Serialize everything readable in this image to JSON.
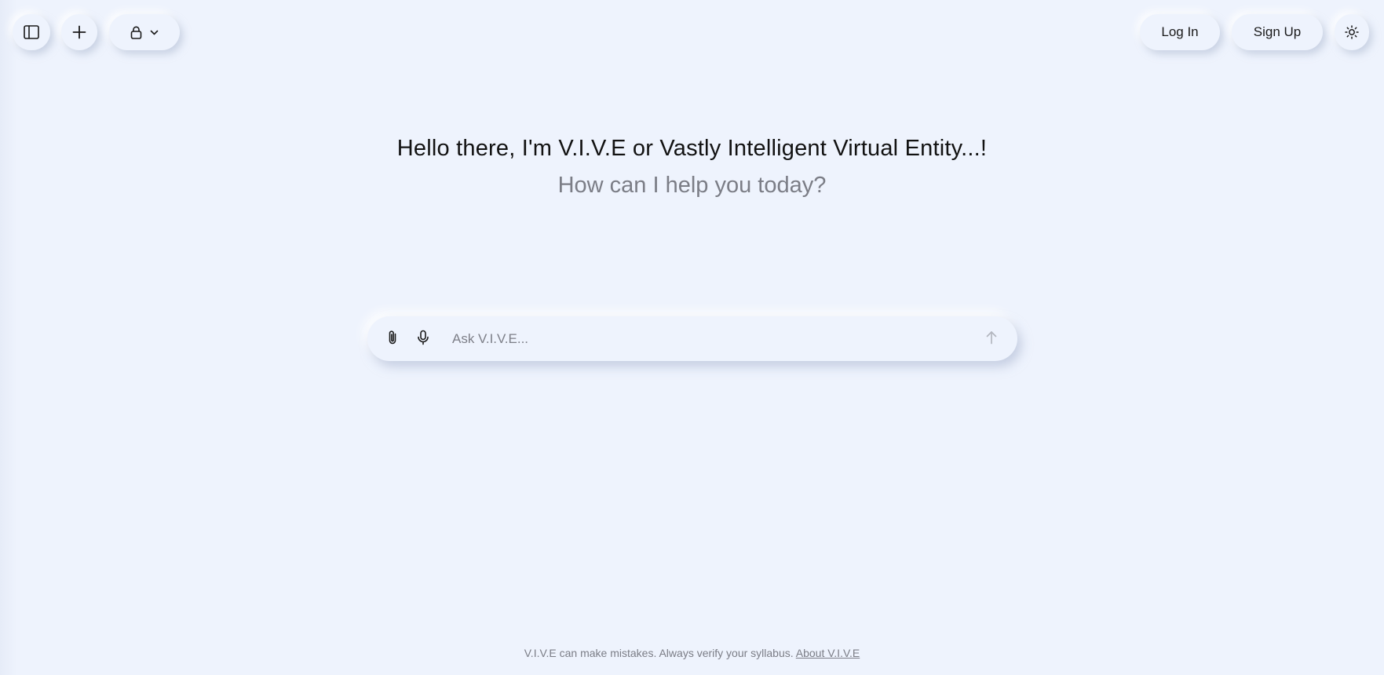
{
  "toolbar": {
    "sidebar_toggle_icon": "sidebar-icon",
    "new_chat_icon": "plus-icon",
    "visibility_icon": "lock-icon",
    "visibility_chevron_icon": "chevron-down-icon",
    "login_label": "Log In",
    "signup_label": "Sign Up",
    "theme_icon": "sun-icon"
  },
  "hero": {
    "title": "Hello there, I'm V.I.V.E or Vastly Intelligent Virtual Entity...!",
    "subtitle": "How can I help you today?"
  },
  "composer": {
    "placeholder": "Ask V.I.V.E...",
    "value": "",
    "attach_icon": "paperclip-icon",
    "mic_icon": "microphone-icon",
    "send_icon": "arrow-up-icon"
  },
  "footer": {
    "disclaimer": "V.I.V.E can make mistakes. Always verify your syllabus.",
    "about_link": "About V.I.V.E"
  },
  "colors": {
    "background": "#eef3fd",
    "text_primary": "#121212",
    "text_muted": "#7b7d86",
    "send_icon": "#b3b6bf"
  }
}
